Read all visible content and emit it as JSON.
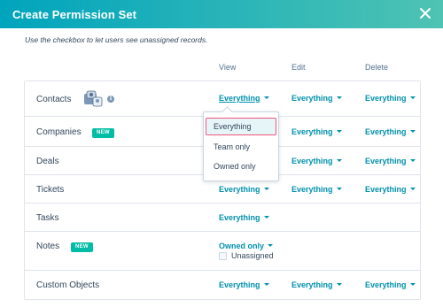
{
  "modal": {
    "title": "Create Permission Set",
    "hint": "Use the checkbox to let users see unassigned records."
  },
  "columns": {
    "view": "View",
    "edit": "Edit",
    "delete": "Delete"
  },
  "badge_new": "NEW",
  "info_glyph": "i",
  "rows": [
    {
      "label": "Contacts",
      "view": "Everything",
      "edit": "Everything",
      "delete": "Everything"
    },
    {
      "label": "Companies",
      "badge": "NEW",
      "edit": "Everything",
      "delete": "Everything"
    },
    {
      "label": "Deals",
      "edit": "Everything",
      "delete": "Everything"
    },
    {
      "label": "Tickets",
      "view": "Everything",
      "edit": "Everything",
      "delete": "Everything"
    },
    {
      "label": "Tasks",
      "view": "Everything"
    },
    {
      "label": "Notes",
      "badge": "NEW",
      "view": "Owned only",
      "checkbox_label": "Unassigned",
      "checkbox_checked": false
    },
    {
      "label": "Custom Objects",
      "view": "Everything",
      "edit": "Everything",
      "delete": "Everything"
    }
  ],
  "dropdown_menu": {
    "options": [
      "Everything",
      "Team only",
      "Owned only"
    ],
    "selected": "Everything"
  },
  "colors": {
    "header_gradient_start": "#00a4bd",
    "header_gradient_end": "#4fc3b3",
    "link": "#0091ae",
    "badge": "#00bda5",
    "selected_outline": "#f2547d"
  }
}
